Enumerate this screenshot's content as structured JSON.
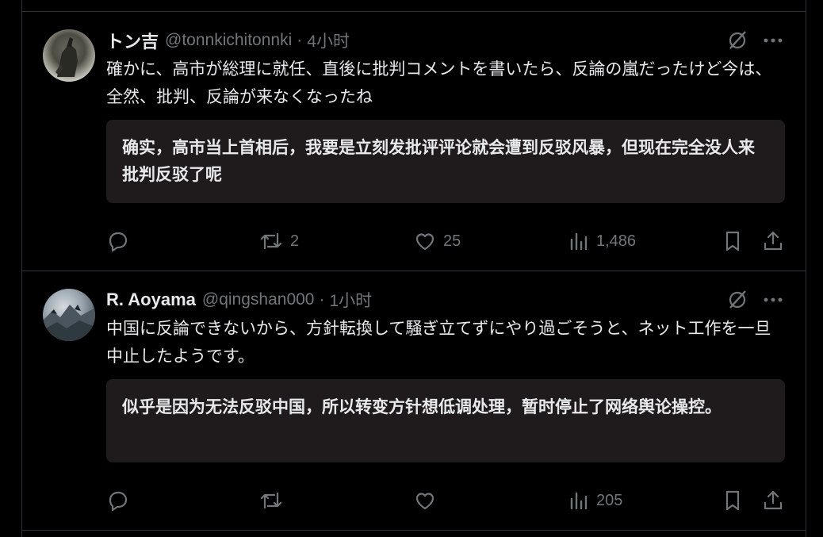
{
  "tweets": [
    {
      "name": "トン吉",
      "handle": "@tonnkichitonnki",
      "separator": "·",
      "time": "4小时",
      "text": "確かに、高市が総理に就任、直後に批判コメントを書いたら、反論の嵐だったけど今は、全然、批判、反論が来なくなったね",
      "translation": "确实，高市当上首相后，我要是立刻发批评评论就会遭到反驳风暴，但现在完全没人来批判反驳了呢",
      "stats": {
        "replies": "",
        "reposts": "2",
        "likes": "25",
        "views": "1,486"
      }
    },
    {
      "name": "R. Aoyama",
      "handle": "@qingshan000",
      "separator": "·",
      "time": "1小时",
      "text": "中国に反論できないから、方針転換して騒ぎ立てずにやり過ごそうと、ネット工作を一旦中止したようです。",
      "translation": "似乎是因为无法反驳中国，所以转变方针想低调处理，暂时停止了网络舆论操控。",
      "stats": {
        "replies": "",
        "reposts": "",
        "likes": "",
        "views": "205"
      }
    }
  ],
  "icons": [
    "grok-icon",
    "more-icon",
    "reply-icon",
    "repost-icon",
    "like-icon",
    "views-icon",
    "bookmark-icon",
    "share-icon"
  ],
  "colors": {
    "background": "#000000",
    "text": "#e7e9ea",
    "muted": "#71767b",
    "border": "#2f3336",
    "translation_bg": "#1f1b1c"
  }
}
